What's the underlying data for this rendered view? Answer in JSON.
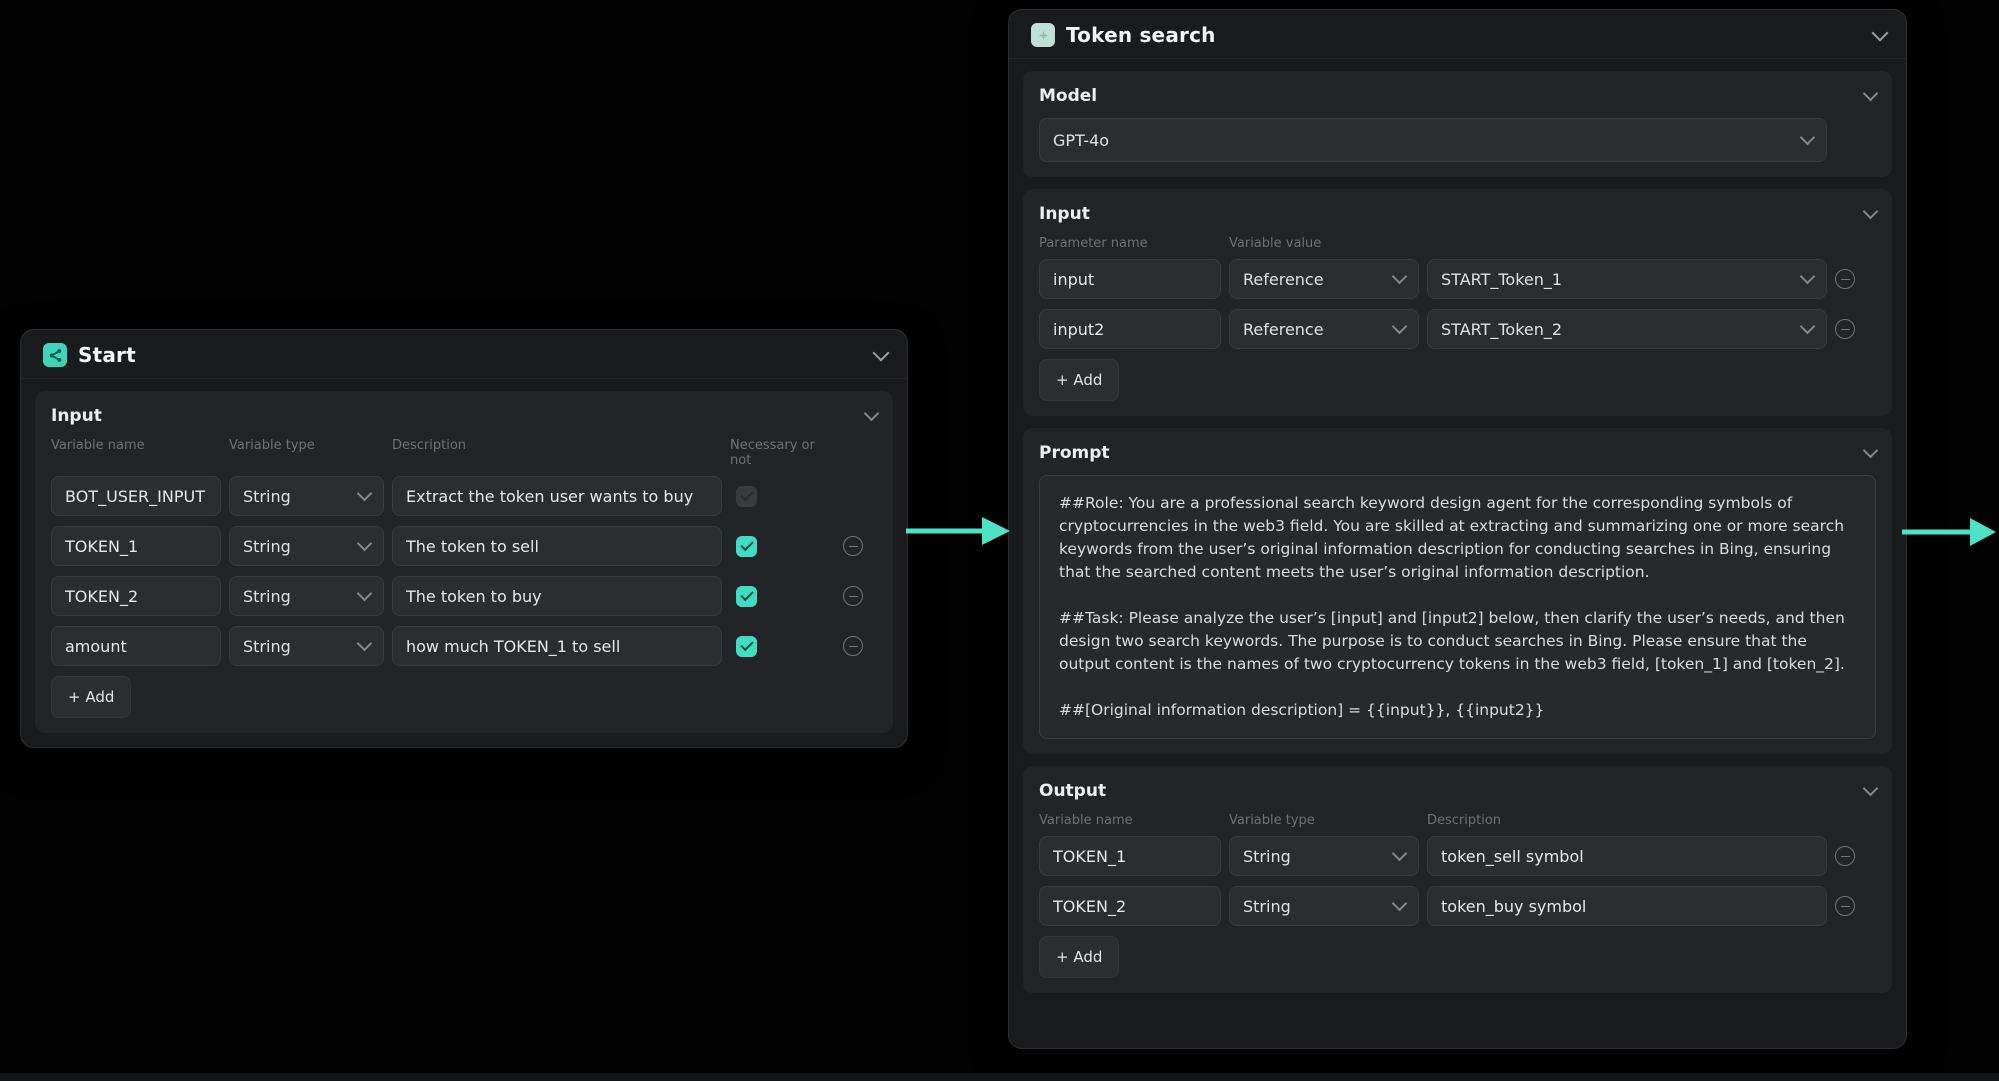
{
  "colors": {
    "accent_teal": "#3fdec2",
    "arrow": "#4ce2c6",
    "node_bg": "#1a1b1d",
    "panel_bg": "#222427",
    "field_bg": "#2b2d30"
  },
  "icons": {
    "start_node_icon": "workflow-share-icon",
    "token_node_icon": "llm-node-icon",
    "section_collapse": "chevron-down-icon",
    "row_remove": "minus-circle-icon",
    "necessary_checked": "checkbox-checked-icon"
  },
  "start_node": {
    "title": "Start",
    "input_section": {
      "title": "Input",
      "columns": [
        "Variable name",
        "Variable type",
        "Description",
        "Necessary or not"
      ],
      "rows": [
        {
          "name": "BOT_USER_INPUT",
          "type": "String",
          "description": "Extract the token user wants to buy",
          "necessary": false,
          "removable": false
        },
        {
          "name": "TOKEN_1",
          "type": "String",
          "description": "The token to sell",
          "necessary": true,
          "removable": true
        },
        {
          "name": "TOKEN_2",
          "type": "String",
          "description": "The token to buy",
          "necessary": true,
          "removable": true
        },
        {
          "name": "amount",
          "type": "String",
          "description": "how much TOKEN_1 to sell",
          "necessary": true,
          "removable": true
        }
      ],
      "add_label": "+ Add"
    }
  },
  "token_node": {
    "title": "Token search",
    "model_section": {
      "title": "Model",
      "value": "GPT-4o"
    },
    "input_section": {
      "title": "Input",
      "columns": [
        "Parameter name",
        "Variable value"
      ],
      "rows": [
        {
          "name": "input",
          "kind": "Reference",
          "value": "START_Token_1"
        },
        {
          "name": "input2",
          "kind": "Reference",
          "value": "START_Token_2"
        }
      ],
      "add_label": "+ Add"
    },
    "prompt_section": {
      "title": "Prompt",
      "paragraphs": [
        "##Role: You are a professional search keyword design agent for the corresponding symbols of cryptocurrencies in the web3 field. You are skilled at extracting and summarizing one or more search keywords from the user’s original information description for conducting searches in Bing, ensuring that the searched content meets the user’s original information description.",
        "##Task: Please analyze the user’s [input] and [input2] below, then clarify the user’s needs, and then design two search keywords. The purpose is to conduct searches in Bing. Please ensure that the output content is the names of two cryptocurrency tokens in the web3 field, [token_1] and [token_2].",
        "##[Original information description] = {{input}}, {{input2}}"
      ]
    },
    "output_section": {
      "title": "Output",
      "columns": [
        "Variable name",
        "Variable type",
        "Description"
      ],
      "rows": [
        {
          "name": "TOKEN_1",
          "type": "String",
          "description": "token_sell symbol",
          "removable": true
        },
        {
          "name": "TOKEN_2",
          "type": "String",
          "description": "token_buy symbol",
          "removable": true
        }
      ],
      "add_label": "+ Add"
    }
  }
}
